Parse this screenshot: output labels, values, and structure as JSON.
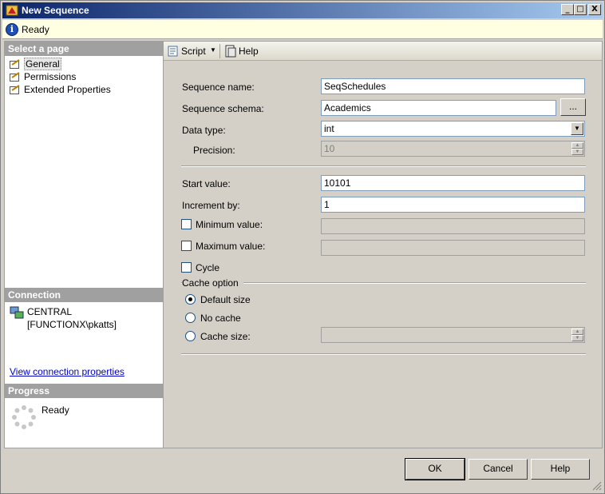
{
  "window": {
    "title": "New Sequence"
  },
  "titlebar_buttons": {
    "minimize": "_",
    "maximize": "□",
    "close": "X"
  },
  "status": {
    "text": "Ready"
  },
  "left": {
    "select_page_header": "Select a page",
    "pages": [
      {
        "label": "General",
        "selected": true
      },
      {
        "label": "Permissions",
        "selected": false
      },
      {
        "label": "Extended Properties",
        "selected": false
      }
    ],
    "connection_header": "Connection",
    "connection": "CENTRAL [FUNCTIONX\\pkatts]",
    "view_connection_link": "View connection properties",
    "progress_header": "Progress",
    "progress_status": "Ready"
  },
  "toolbar": {
    "script": "Script",
    "help": "Help"
  },
  "form": {
    "sequence_name_label": "Sequence name:",
    "sequence_name_value": "SeqSchedules",
    "sequence_schema_label": "Sequence schema:",
    "sequence_schema_value": "Academics",
    "browse_label": "...",
    "data_type_label": "Data type:",
    "data_type_value": "int",
    "precision_label": "Precision:",
    "precision_value": "10",
    "start_value_label": "Start value:",
    "start_value": "10101",
    "increment_label": "Increment by:",
    "increment_value": "1",
    "minimum_label": "Minimum value:",
    "maximum_label": "Maximum value:",
    "cycle_label": "Cycle",
    "cache_option_label": "Cache option",
    "default_size_label": "Default size",
    "no_cache_label": "No cache",
    "cache_size_label": "Cache size:"
  },
  "buttons": {
    "ok": "OK",
    "cancel": "Cancel",
    "help": "Help"
  }
}
